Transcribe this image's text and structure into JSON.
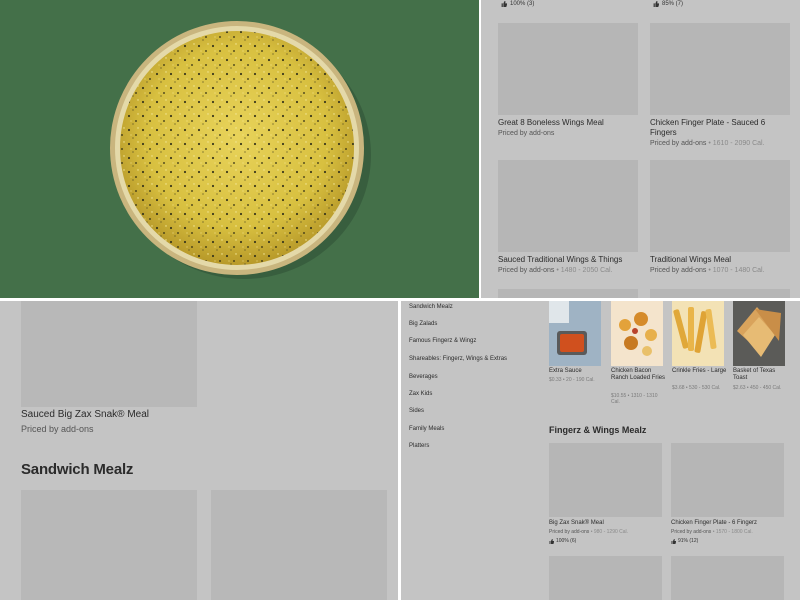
{
  "panel_top_right": {
    "ratings": [
      {
        "label": "100% (3)"
      },
      {
        "label": "85% (7)"
      }
    ],
    "items": [
      {
        "title": "Great 8 Boneless Wings Meal",
        "price": "Priced by add-ons",
        "cal": ""
      },
      {
        "title": "Chicken Finger Plate - Sauced 6 Fingers",
        "price": "Priced by add-ons",
        "cal": " • 1610 - 2090 Cal."
      },
      {
        "title": "Sauced Traditional Wings & Things",
        "price": "Priced by add-ons",
        "cal": " • 1480 - 2050 Cal."
      },
      {
        "title": "Traditional Wings Meal",
        "price": "Priced by add-ons",
        "cal": " • 1070 - 1480 Cal."
      }
    ]
  },
  "panel_bottom_left": {
    "item": {
      "title": "Sauced Big Zax Snak® Meal",
      "price": "Priced by add-ons"
    },
    "section_title": "Sandwich Mealz"
  },
  "panel_bottom_right": {
    "nav": [
      "Sandwich Mealz",
      "Big Zalads",
      "Famous Fingerz & Wingz",
      "Shareables: Fingerz, Wings & Extras",
      "Beverages",
      "Zax Kids",
      "Sides",
      "Family Meals",
      "Platters"
    ],
    "sides": [
      {
        "title": "Extra Sauce",
        "sub": "$0.33 • 20 - 190 Cal."
      },
      {
        "title": "Chicken Bacon Ranch Loaded Fries",
        "sub": "$10.55 • 1310 - 1310 Cal."
      },
      {
        "title": "Crinkle Fries - Large",
        "sub": "$3.68 • 530 - 530 Cal."
      },
      {
        "title": "Basket of Texas Toast",
        "sub": "$2.63 • 450 - 450 Cal."
      }
    ],
    "section_title": "Fingerz & Wings Mealz",
    "meals": [
      {
        "title": "Big Zax Snak® Meal",
        "price": "Priced by add-ons",
        "cal": " • 980 - 1290 Cal.",
        "rating": "100% (6)"
      },
      {
        "title": "Chicken Finger Plate - 6 Fingerz",
        "price": "Priced by add-ons",
        "cal": " • 1570 - 1800 Cal.",
        "rating": "91% (12)"
      }
    ]
  },
  "colors": {
    "photo_bg": "#447049",
    "overlay_gray": "#c4c4c4",
    "placeholder_tile": "#b6b6b6"
  }
}
